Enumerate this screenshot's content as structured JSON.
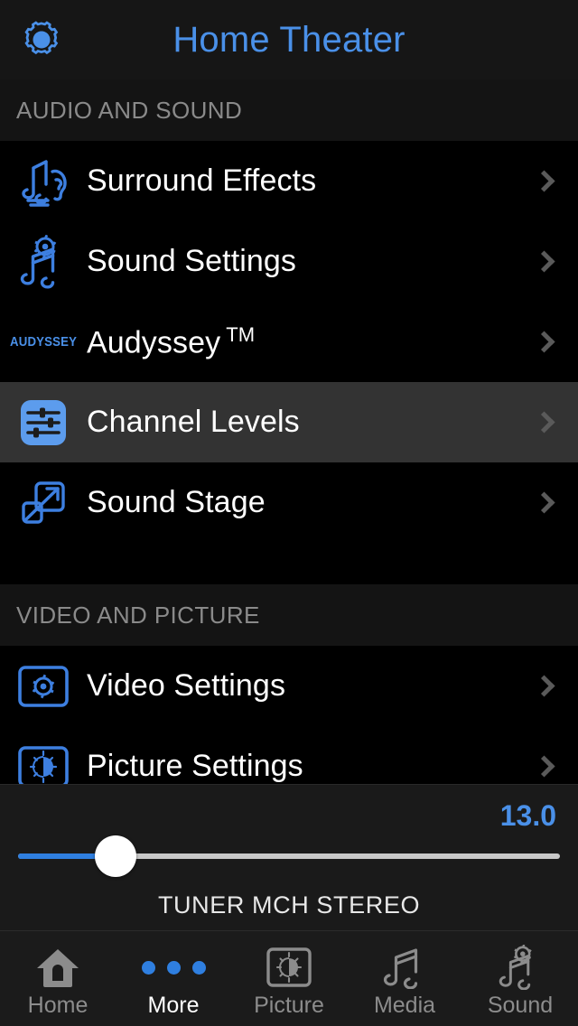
{
  "header": {
    "gear_icon": "gear-icon",
    "title": "Home Theater"
  },
  "sections": [
    {
      "title": "AUDIO AND SOUND",
      "items": [
        {
          "label": "Surround Effects",
          "icon": "music-note-ear-icon",
          "selected": false,
          "chevron": "chevron-right-icon"
        },
        {
          "label": "Sound Settings",
          "icon": "music-note-gear-icon",
          "selected": false,
          "chevron": "chevron-right-icon"
        },
        {
          "label": "Audyssey",
          "icon": "audyssey-logo-icon",
          "icon_text": "AUDYSSEY",
          "suffix": "TM",
          "selected": false,
          "chevron": "chevron-right-icon"
        },
        {
          "label": "Channel Levels",
          "icon": "sliders-icon",
          "selected": true,
          "chevron": "chevron-right-icon"
        },
        {
          "label": "Sound Stage",
          "icon": "expand-arrow-icon",
          "selected": false,
          "chevron": "chevron-right-icon"
        }
      ]
    },
    {
      "title": "VIDEO AND PICTURE",
      "items": [
        {
          "label": "Video Settings",
          "icon": "screen-gear-icon",
          "selected": false,
          "chevron": "chevron-right-icon"
        },
        {
          "label": "Picture Settings",
          "icon": "screen-brightness-icon",
          "selected": false,
          "chevron": "chevron-right-icon"
        }
      ]
    }
  ],
  "volume": {
    "value": "13.0",
    "percent": 18,
    "status": "TUNER  MCH STEREO"
  },
  "tabs": [
    {
      "label": "Home",
      "icon": "home-icon",
      "active": false
    },
    {
      "label": "More",
      "icon": "ellipsis-icon",
      "active": true
    },
    {
      "label": "Picture",
      "icon": "screen-brightness-icon",
      "active": false
    },
    {
      "label": "Media",
      "icon": "music-notes-icon",
      "active": false
    },
    {
      "label": "Sound",
      "icon": "music-note-gear-icon",
      "active": false
    }
  ],
  "colors": {
    "accent": "#4a90e8",
    "slider_fill": "#2f7fe0",
    "row_selected_bg": "#333333",
    "section_header_bg": "#141414",
    "label": "#ffffff",
    "muted": "#8a8a8a"
  }
}
